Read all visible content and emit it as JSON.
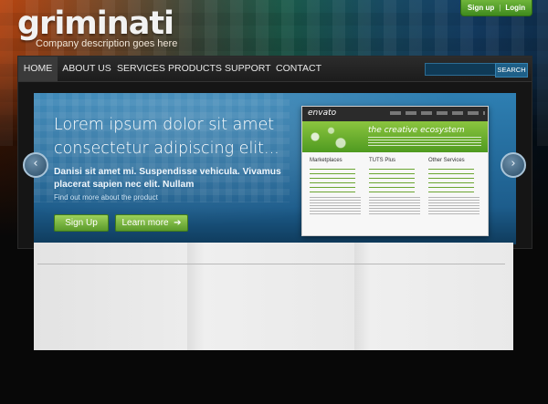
{
  "header": {
    "logo": "griminati",
    "description": "Company description goes here",
    "signup": "Sign up",
    "login": "Login",
    "separator": "|"
  },
  "nav": {
    "items": [
      "HOME",
      "ABOUT US",
      "SERVICES",
      "PRODUCTS",
      "SUPPORT",
      "CONTACT"
    ],
    "active": "HOME",
    "search_button": "SEARCH",
    "search_value": ""
  },
  "banner": {
    "headline": "Lorem ipsum dolor sit amet consectetur adipiscing elit...",
    "subtext": "Danisi sit amet mi. Suspendisse vehicula. Vivamus placerat sapien nec elit. Nullam",
    "find_more": "Find out more about the product",
    "signup_button": "Sign Up",
    "learn_more_button": "Learn more",
    "prev_arrow": "left-arrow-icon",
    "next_arrow": "right-arrow-icon"
  },
  "preview": {
    "brand": "envato",
    "tagline": "the creative ecosystem",
    "columns": [
      "Marketplaces",
      "TUTS Plus",
      "Other Services"
    ]
  },
  "colors": {
    "accent_green": "#6fb53a",
    "nav_bg": "#2c2c2c",
    "banner_blue": "#2e7fb2"
  }
}
